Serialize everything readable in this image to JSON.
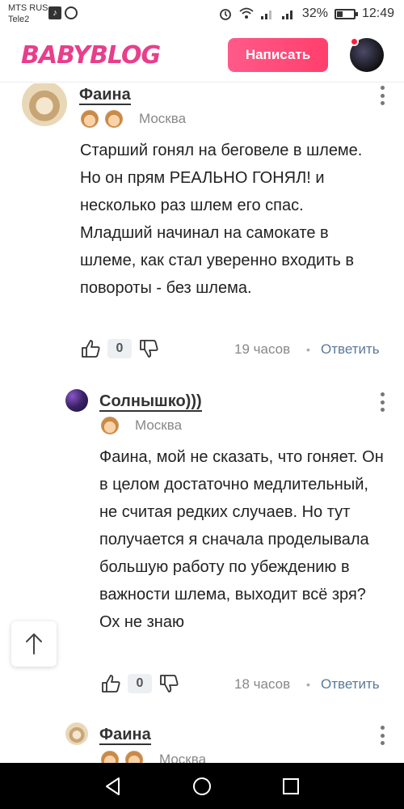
{
  "status_bar": {
    "carrier_1": "MTS RUS",
    "carrier_2": "Tele2",
    "battery_percent": "32%",
    "battery_level": 0.32,
    "time": "12:49"
  },
  "header": {
    "logo": "BABYBLOG",
    "write_button": "Написать"
  },
  "comments": [
    {
      "author": "Фаина",
      "city": "Москва",
      "kids": 2,
      "text": [
        "Старший гонял на беговеле в шлеме. Но он прям РЕАЛЬНО ГОНЯЛ! и несколько раз шлем его спас.",
        "Младший начинал на самокате в шлеме, как стал уверенно входить в повороты - без шлема."
      ],
      "likes": "0",
      "time": "19 часов",
      "separator": "•",
      "reply": "Ответить"
    },
    {
      "author": "Солнышко)))",
      "city": "Москва",
      "kids": 1,
      "text": [
        "Фаина, мой не сказать, что гоняет. Он в целом достаточно медлительный, не считая редких случаев. Но тут получается я сначала проделывала большую работу по убеждению в важности шлема, выходит всё зря? Ох не знаю"
      ],
      "likes": "0",
      "time": "18 часов",
      "separator": "•",
      "reply": "Ответить"
    },
    {
      "author": "Фаина",
      "city": "Москва",
      "kids": 2
    }
  ],
  "colors": {
    "brand_pink": "#e83e8c",
    "button_gradient_start": "#ff5a8a",
    "button_gradient_end": "#ff3f6c",
    "reply_link": "#5a7a9a",
    "notification_dot": "#ff1e3c"
  },
  "icons": {
    "like": "thumbs-up-icon",
    "dislike": "thumbs-down-icon",
    "more": "vertical-dots-icon",
    "scroll_top": "arrow-up-icon",
    "nav_back": "triangle-back-icon",
    "nav_home": "circle-home-icon",
    "nav_recent": "square-recent-icon"
  }
}
